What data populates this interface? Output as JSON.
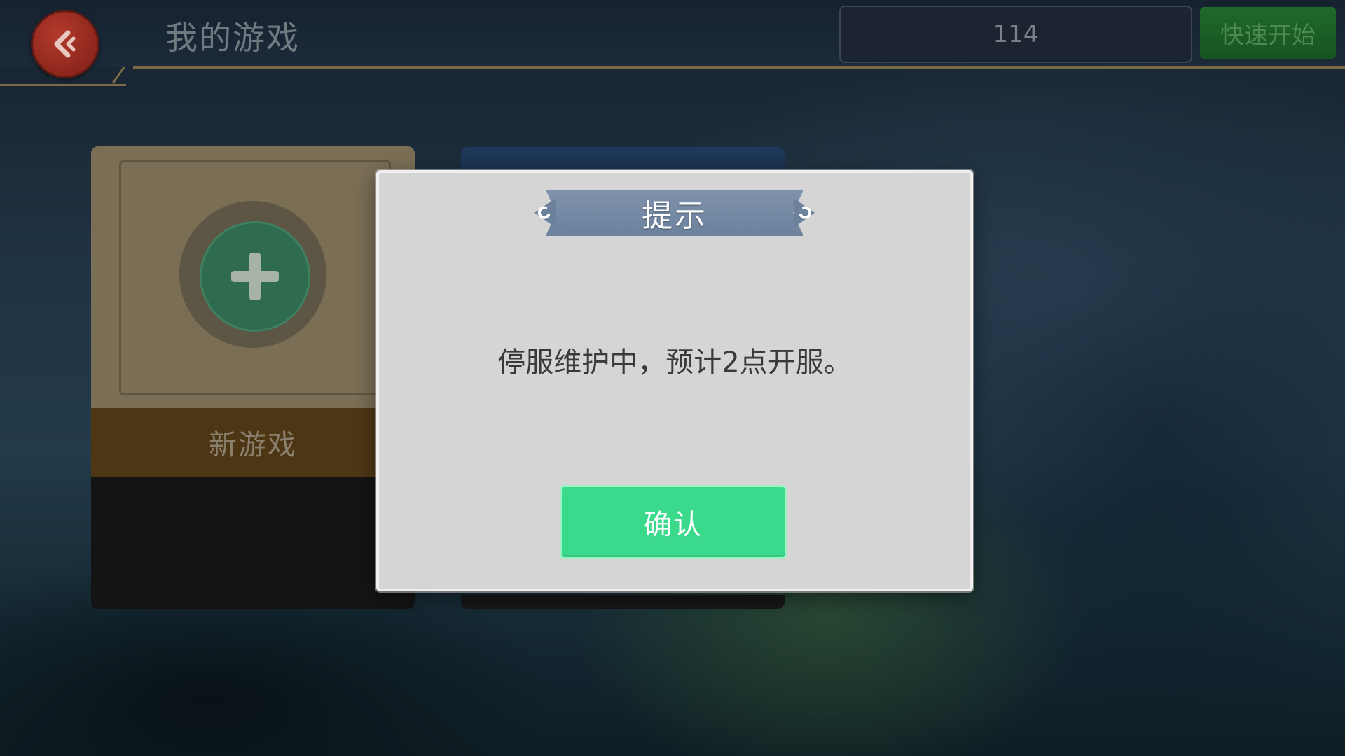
{
  "header": {
    "title": "我的游戏",
    "search_value": "114",
    "quick_start_label": "快速开始"
  },
  "cards": {
    "new_game_label": "新游戏"
  },
  "dialog": {
    "title": "提示",
    "message": "停服维护中，预计2点开服。",
    "confirm_label": "确认"
  },
  "colors": {
    "confirm_button": "#3bd98c",
    "back_button": "#a0302a",
    "quick_start_button": "#1f6a2a",
    "dialog_background": "#d5d5d5",
    "title_banner": "#7b8fa9"
  },
  "icons": {
    "back": "chevron-left-icon",
    "add": "plus-icon"
  }
}
